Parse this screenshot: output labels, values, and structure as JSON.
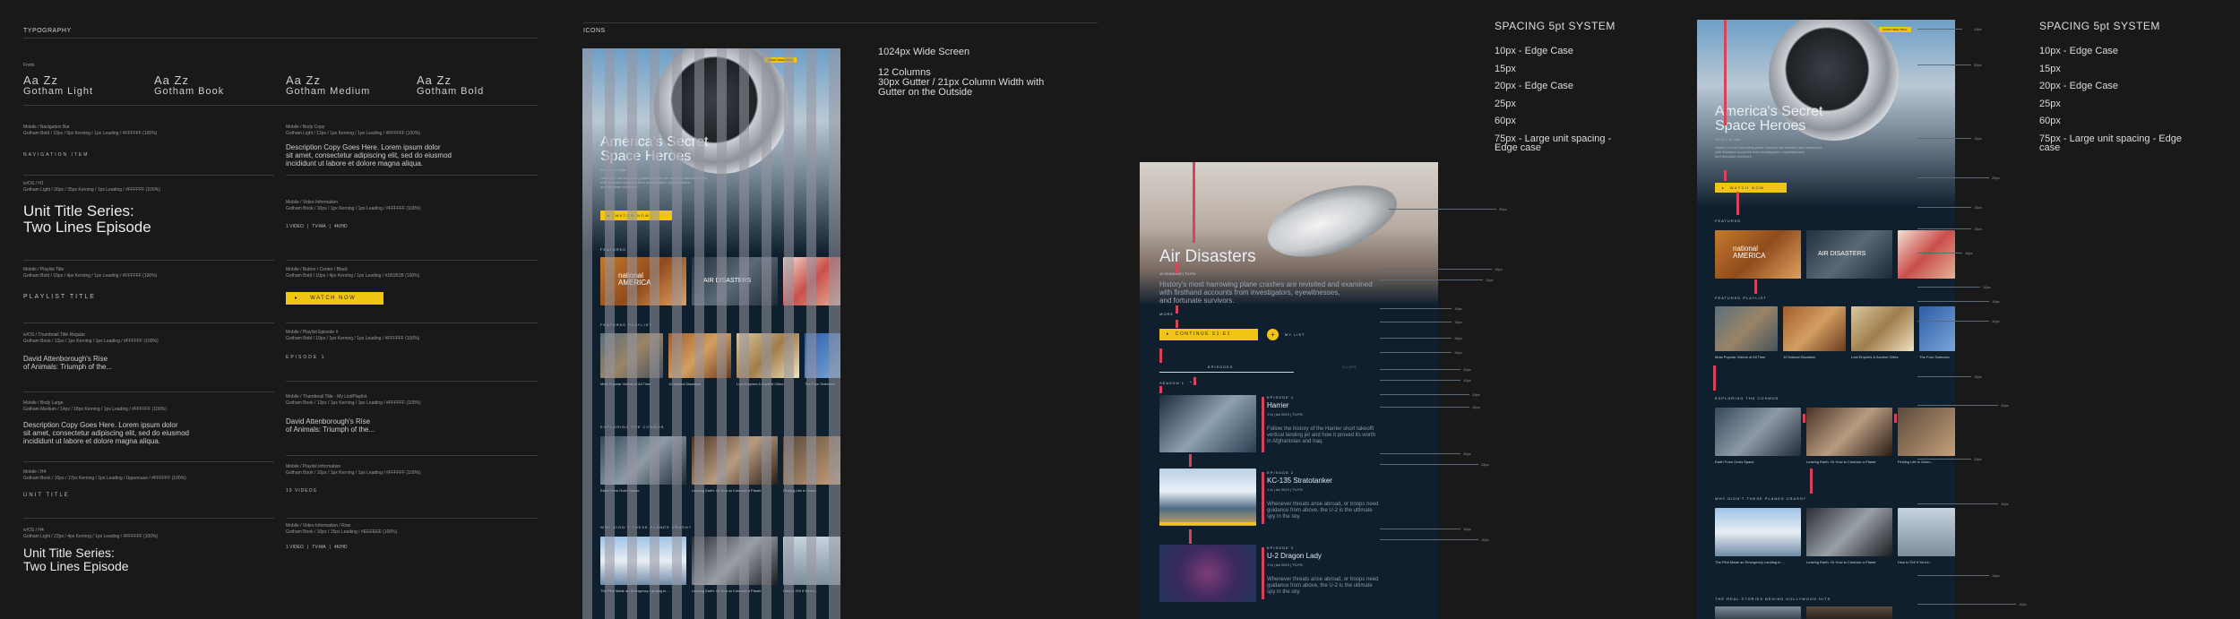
{
  "typography": {
    "section_title": "TYPOGRAPHY",
    "fonts_label": "Fonts",
    "fonts": [
      {
        "sample": "Aa Zz",
        "name": "Gotham Light"
      },
      {
        "sample": "Aa Zz",
        "name": "Gotham Book"
      },
      {
        "sample": "Aa Zz",
        "name": "Gotham Medium"
      },
      {
        "sample": "Aa Zz",
        "name": "Gotham Bold"
      }
    ],
    "left_specs": [
      {
        "title": "Mobile / Navigation Bar",
        "detail": "Gotham Bold / 10px / 5px Kerning / 1px Leading / #FFFFFF (100%)",
        "sample": "NAVIGATION ITEM"
      },
      {
        "title": "iv/OS / H1",
        "detail": "Gotham Light / 30px / 35px Kerning / 1px Leading / #FFFFFF (100%)",
        "sample": "Unit Title Series:\nTwo Lines Episode"
      },
      {
        "title": "Mobile / Playlist Title",
        "detail": "Gotham Bold / 10px / 4px Kerning / 1px Leading / #FFFFFF (100%)",
        "sample": "PLAYLIST TITLE"
      },
      {
        "title": "iv/OS / Thumbnail Title Regular",
        "detail": "Gotham Book / 12px / 1px Kerning / 1px Leading / #FFFFFF (100%)",
        "sample": "David Attenborough's Rise\nof Animals: Triumph of the..."
      },
      {
        "title": "Mobile / Body Large",
        "detail": "Gotham Medium / 14px / 18px Kerning / 1px Leading / #FFFFFF (100%)",
        "sample": "Description Copy Goes Here. Lorem ipsum dolor\nsit amet, consectetur adipiscing elit, sed do eiusmod\nincididunt ut labore et dolore magna aliqua."
      },
      {
        "title": "Mobile / H4",
        "detail": "Gotham Book / 10px / 17px Kerning / 1px Leading / Uppercase / #FFFFFF (100%)",
        "sample": "UNIT TITLE"
      },
      {
        "title": "iv/OS / H4",
        "detail": "Gotham Light / 22px / 4px Kerning / 1px Leading / #FFFFFF (100%)",
        "sample": "Unit Title Series:\nTwo Lines Episode"
      }
    ],
    "right_specs": [
      {
        "title": "Mobile / Body Copy",
        "detail": "Gotham Light / 12px / 1px Kerning / 1px Leading / #FFFFFF (100%)",
        "sample": "Description Copy Goes Here. Lorem ipsum dolor\nsit amet, consectetur adipiscing elit, sed do eiusmod\nincididunt ut labore et dolore magna aliqua."
      },
      {
        "title": "Mobile / Video Information",
        "detail": "Gotham Book / 10px / 1px Kerning / 1px Leading / #FFFFFF (100%)",
        "sample": "1 VIDEO   |   TV-MA   |   4K/HD"
      },
      {
        "title": "Mobile / Button / Center / Black",
        "detail": "Gotham Bold / 10px / 4px Kerning / 1px Leading / #1B1B1B (100%)",
        "sample": "WATCH NOW"
      },
      {
        "title": "Mobile / Playlist Episode #",
        "detail": "Gotham Bold / 10px / 1px Kerning / 1px Leading / #FFFFFF (100%)",
        "sample": "EPISODE 1"
      },
      {
        "title": "Mobile / Thumbnail Title - My List/Playlist",
        "detail": "Gotham Book / 12px / 1px Kerning / 1px Leading / #FFFFFF (100%)",
        "sample": "David Attenborough's Rise\nof Animals: Triumph of the..."
      },
      {
        "title": "Mobile / Playlist Information",
        "detail": "Gotham Book / 10px / 1px Kerning / 1px Leading / #FFFFFF (100%)",
        "sample": "10 VIDEOS"
      },
      {
        "title": "Mobile / Video Information / Row",
        "detail": "Gotham Book / 10px / 15px Leading / #EEEEEE (100%)",
        "sample": "1 VIDEO   |   TV-MA   |   4K/HD"
      }
    ]
  },
  "icons": {
    "section_title": "ICONS"
  },
  "grid": {
    "title": "1024px Wide Screen",
    "columns": "12 Columns",
    "detail": "30px Gutter / 21px Column Width with\nGutter on the Outside"
  },
  "phone_home": {
    "hero_title": "America's Secret\nSpace Heroes",
    "meta": "PG-13  |  1h 30m",
    "desc": "History's most harrowing plane crashes are revisited and examined,\nwith firsthand accounts from investigators, eyewitnesses,\nand fortunate survivors.",
    "cta": "WATCH NOW",
    "badge": "START FREE TRIAL",
    "rows": [
      {
        "label": "FEATURED",
        "items": [
          "",
          "",
          "",
          ""
        ]
      },
      {
        "label": "FEATURED PLAYLIST",
        "items": [
          "Most Popular Videos of All Time",
          "10 Natural Disasters",
          "Lost Empires & Ancient Cities",
          "The Four Sciences"
        ]
      },
      {
        "label": "EXPLORING THE COSMOS",
        "items": [
          "Earth From Outer Space",
          "Leaving Earth: Or How to Colonize a Planet",
          "Finding Life in Outer..."
        ]
      },
      {
        "label": "WHY DIDN'T THESE PLANES CRASH?",
        "items": [
          "The Pilot Made an Emergency Landing in ...",
          "Leaving Earth: Or How to Colonize a Planet",
          "How to Tell If You're..."
        ]
      },
      {
        "label": "THE REAL STORIES BEHIND HOLLYWOOD HITS",
        "items": []
      }
    ],
    "logo_text": "national\nAMERICA",
    "logo_text2": "AIR DISASTERS"
  },
  "phone_show": {
    "title": "Air Disasters",
    "meta": "10 SEASONS  |  TV-PG",
    "desc": "History's most harrowing plane crashes are revisited and examined\nwith firsthand accounts from investigators, eyewitnesses,\nand fortunate survivors.",
    "more": "MORE",
    "cta": "CONTINUE S1:E1",
    "mylist": "MY LIST",
    "tab_episodes": "EPISODES",
    "tab_clips": "CLIPS",
    "season": "SEASON 1",
    "episodes": [
      {
        "num": "EPISODE 1",
        "title": "Harrier",
        "info": "1 hr  |  Air 2019  |  TV-PG",
        "desc": "Follow the history of the Harrier short takeoff/\nvertical landing jet and how it proved its worth\nin Afghanistan and Iraq."
      },
      {
        "num": "EPISODE 2",
        "title": "KC-135 Stratotanker",
        "info": "1 hr  |  Air 2019  |  TV-PG",
        "desc": "Whenever threats arise abroad, or troops need\nguidance from above, the U-2 is the ultimate\nspy in the sky."
      },
      {
        "num": "EPISODE 3",
        "title": "U-2 Dragon Lady",
        "info": "1 hr  |  Air 2019  |  TV-PG",
        "desc": "Whenever threats arise abroad, or troops need\nguidance from above, the U-2 is the ultimate\nspy in the sky."
      }
    ],
    "measures": [
      "30px",
      "15px",
      "10px",
      "10px",
      "10px",
      "15px",
      "10px",
      "10px",
      "10px",
      "15px",
      "15px",
      "20px",
      "15px",
      "10px",
      "10px",
      "15px"
    ]
  },
  "spacing_a": {
    "title": "SPACING 5pt SYSTEM",
    "items": [
      "10px - Edge Case",
      "15px",
      "20px - Edge Case",
      "25px",
      "60px",
      "75px - Large unit spacing -\nEdge case"
    ]
  },
  "spacing_b": {
    "title": "SPACING 5pt SYSTEM",
    "items": [
      "10px - Edge Case",
      "15px",
      "20px - Edge Case",
      "25px",
      "60px",
      "75px - Large unit spacing - Edge\ncase"
    ]
  },
  "colors": {
    "background": "#191919",
    "accent": "#F2C515",
    "measure_red": "#D6435A",
    "phone_bg": "#0F1F2E"
  }
}
